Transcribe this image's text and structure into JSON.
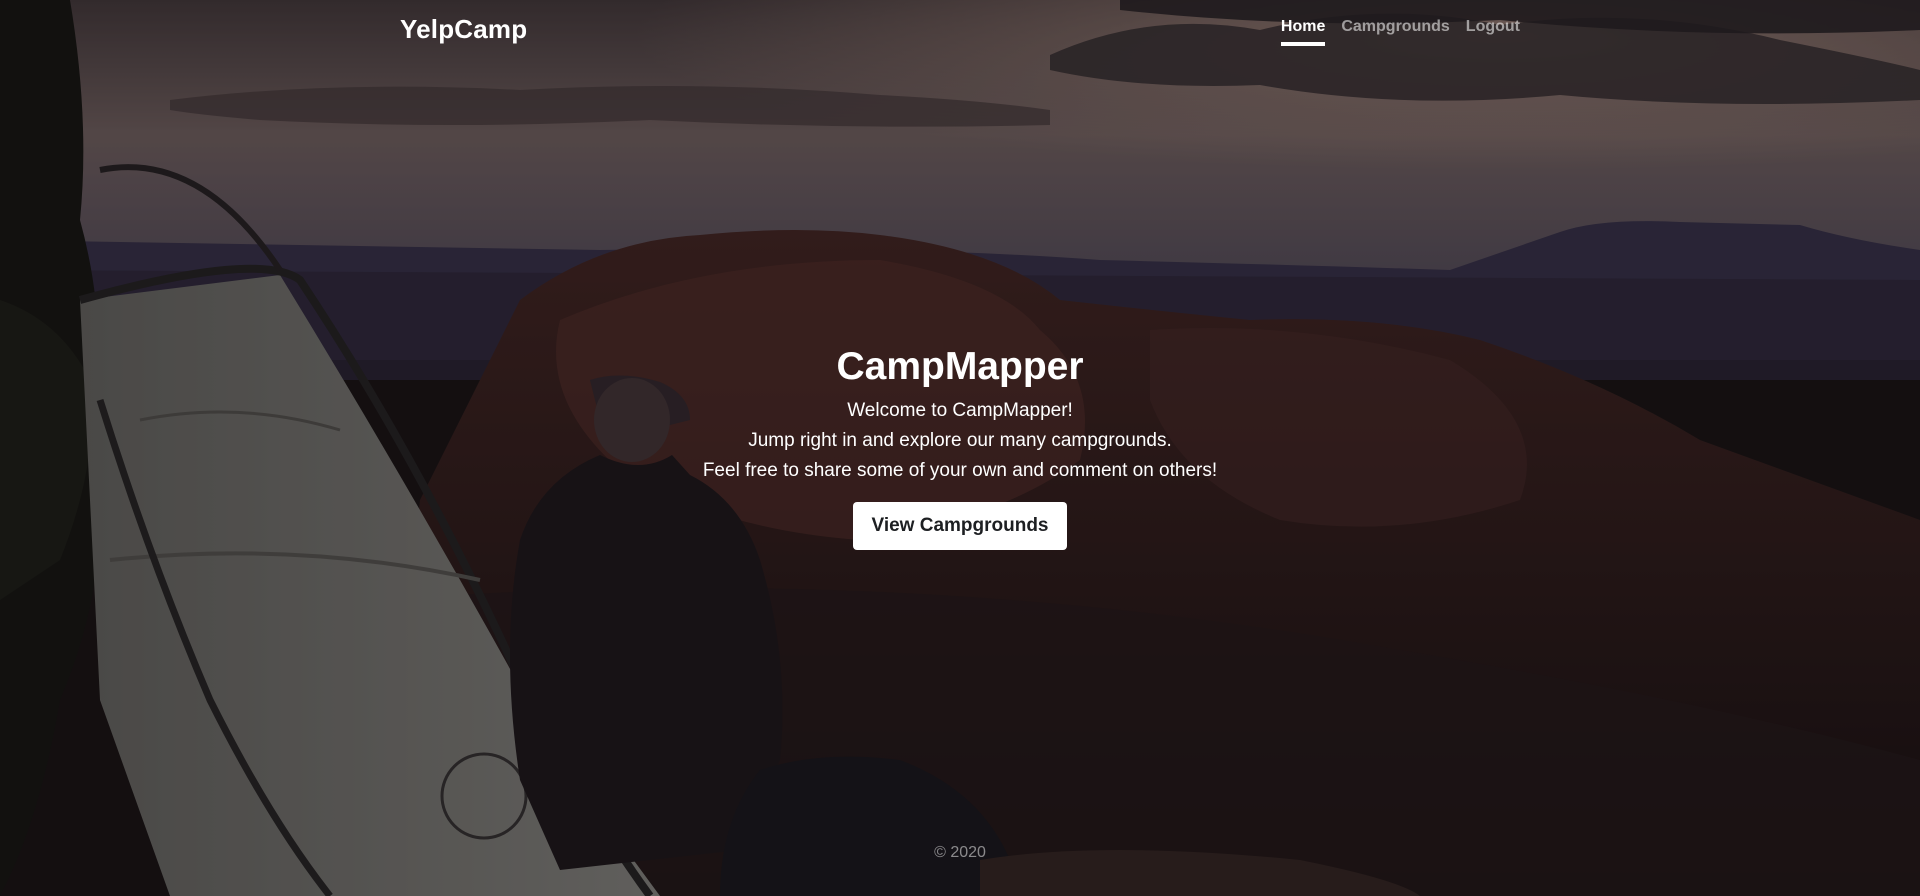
{
  "navbar": {
    "brand": "YelpCamp",
    "links": [
      {
        "label": "Home",
        "active": true
      },
      {
        "label": "Campgrounds",
        "active": false
      },
      {
        "label": "Logout",
        "active": false
      }
    ]
  },
  "hero": {
    "title": "CampMapper",
    "lines": [
      "Welcome to CampMapper!",
      "Jump right in and explore our many campgrounds.",
      "Feel free to share some of your own and comment on others!"
    ],
    "cta_label": "View Campgrounds"
  },
  "footer": {
    "text": "© 2020"
  },
  "colors": {
    "text": "#ffffff",
    "muted_nav": "#9c9a9c",
    "button_bg": "#ffffff",
    "button_text": "#1d1f22"
  }
}
